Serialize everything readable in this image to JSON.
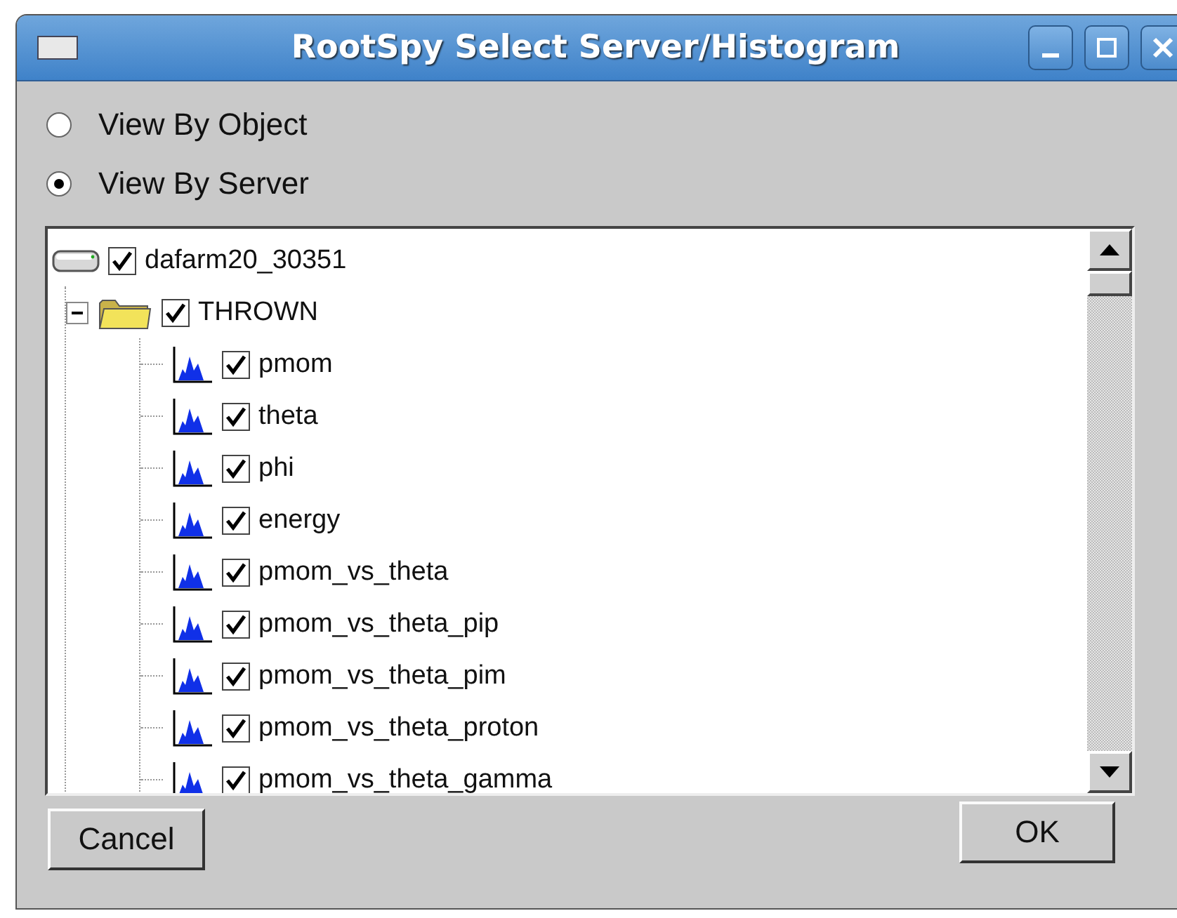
{
  "window": {
    "title": "RootSpy Select Server/Histogram"
  },
  "view_options": [
    {
      "label": "View By Object",
      "selected": false
    },
    {
      "label": "View By Server",
      "selected": true
    }
  ],
  "tree": [
    {
      "kind": "server",
      "label": "dafarm20_30351",
      "checked": true,
      "children": [
        {
          "kind": "folder",
          "label": "THROWN",
          "checked": true,
          "expanded": true,
          "children": [
            {
              "kind": "histogram",
              "label": "pmom",
              "checked": true
            },
            {
              "kind": "histogram",
              "label": "theta",
              "checked": true
            },
            {
              "kind": "histogram",
              "label": "phi",
              "checked": true
            },
            {
              "kind": "histogram",
              "label": "energy",
              "checked": true
            },
            {
              "kind": "histogram",
              "label": "pmom_vs_theta",
              "checked": true
            },
            {
              "kind": "histogram",
              "label": "pmom_vs_theta_pip",
              "checked": true
            },
            {
              "kind": "histogram",
              "label": "pmom_vs_theta_pim",
              "checked": true
            },
            {
              "kind": "histogram",
              "label": "pmom_vs_theta_proton",
              "checked": true
            },
            {
              "kind": "histogram",
              "label": "pmom_vs_theta_gamma",
              "checked": true
            }
          ]
        }
      ]
    }
  ],
  "buttons": [
    {
      "label": "Cancel"
    },
    {
      "label": "OK"
    }
  ]
}
